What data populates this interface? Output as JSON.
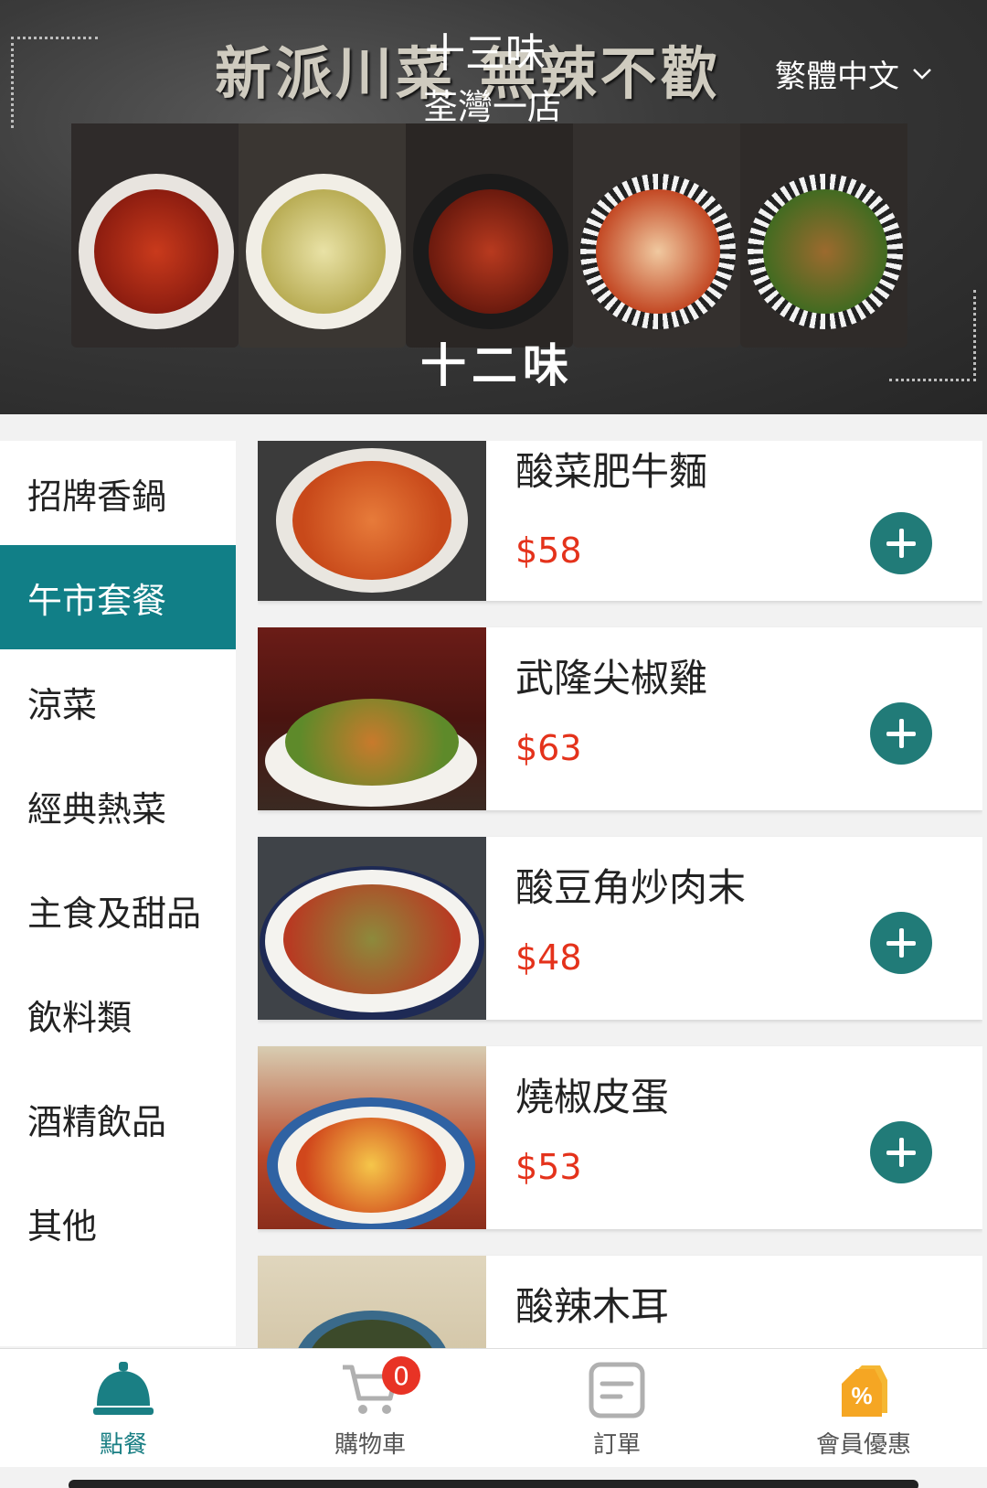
{
  "banner": {
    "slogan": "新派川菜   無辣不歡",
    "store_name": "十三味",
    "branch_name": "荃灣一店",
    "language": "繁體中文",
    "logo_text": "十二味"
  },
  "categories": [
    {
      "label": "招牌香鍋"
    },
    {
      "label": "午市套餐"
    },
    {
      "label": "涼菜"
    },
    {
      "label": "經典熱菜"
    },
    {
      "label": "主食及甜品"
    },
    {
      "label": "飲料類"
    },
    {
      "label": "酒精飲品"
    },
    {
      "label": "其他"
    }
  ],
  "active_category": "午市套餐",
  "menu_items": [
    {
      "name": "酸菜肥牛麵",
      "price": "$58"
    },
    {
      "name": "武隆尖椒雞",
      "price": "$63"
    },
    {
      "name": "酸豆角炒肉末",
      "price": "$48"
    },
    {
      "name": "燒椒皮蛋",
      "price": "$53"
    },
    {
      "name": "酸辣木耳",
      "price": ""
    }
  ],
  "tabbar": {
    "order": "點餐",
    "cart": "購物車",
    "cart_count": "0",
    "orders": "訂單",
    "member": "會員優惠"
  },
  "colors": {
    "accent": "#117f87",
    "price": "#e4321b",
    "badge": "#e83325",
    "member_icon": "#f5a623"
  }
}
